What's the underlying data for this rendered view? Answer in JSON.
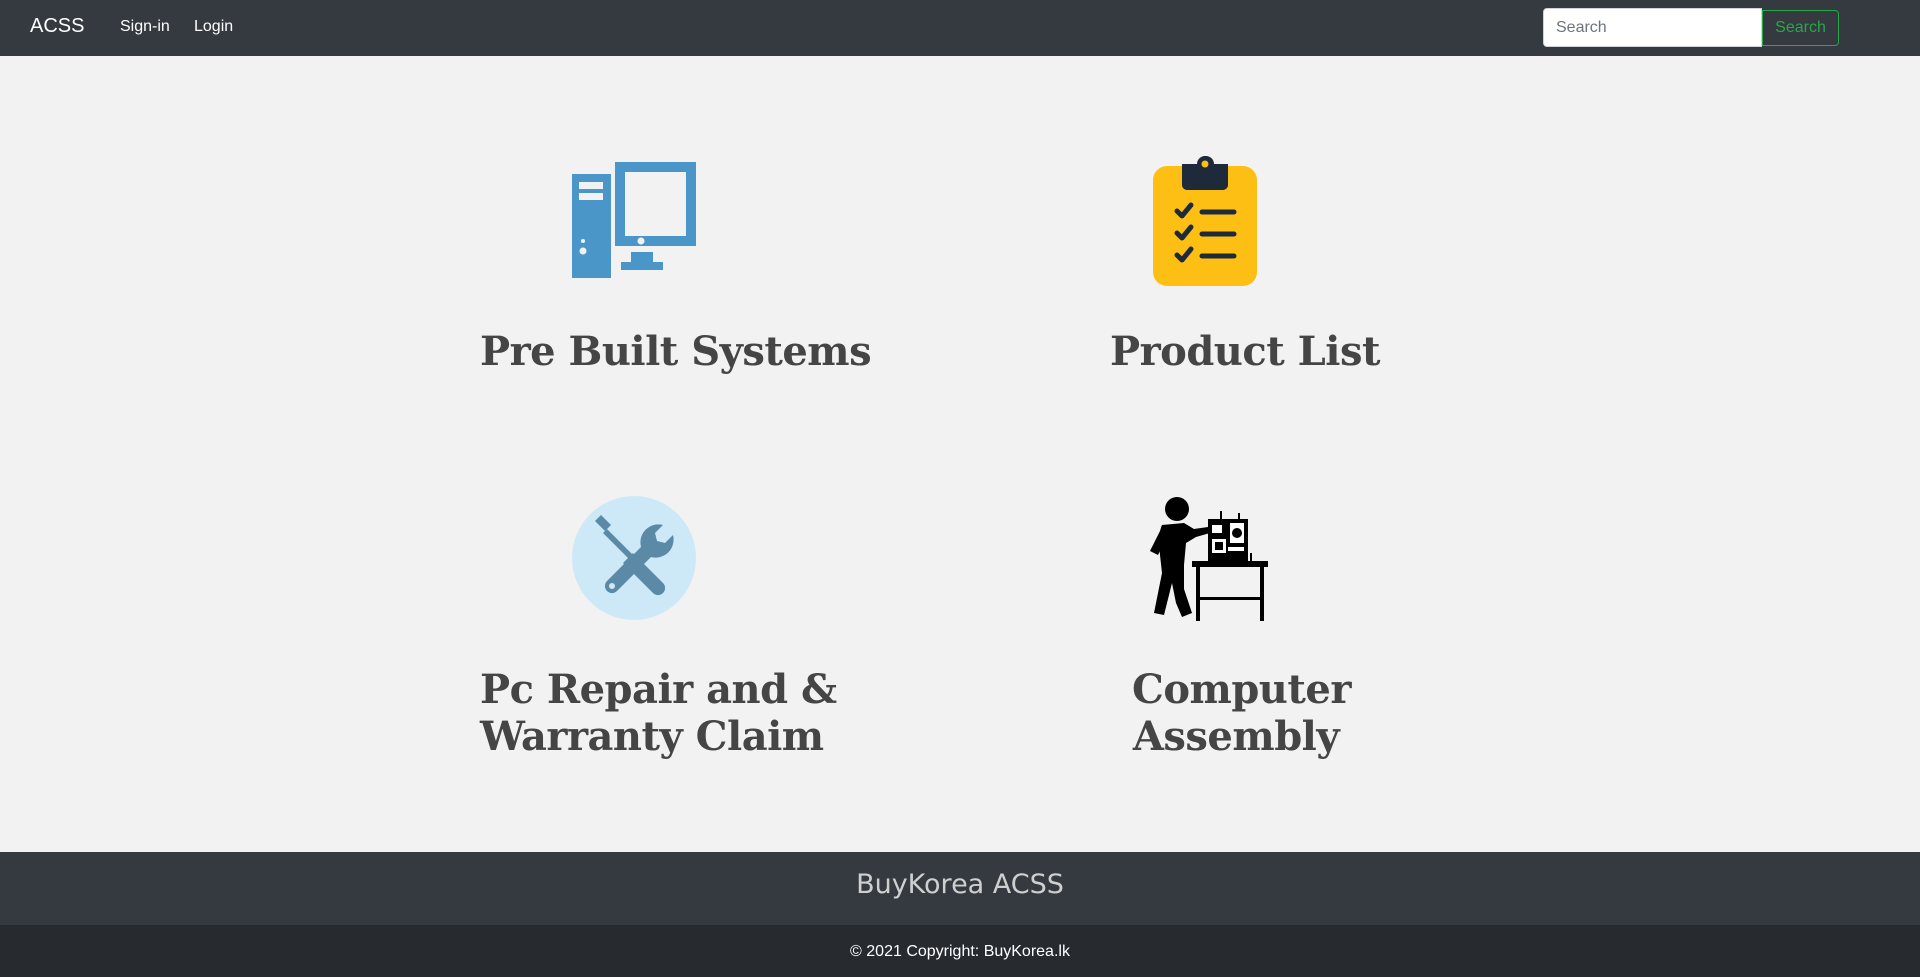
{
  "navbar": {
    "brand": "ACSS",
    "links": [
      "Sign-in",
      "Login"
    ],
    "search": {
      "placeholder": "Search",
      "button_label": "Search"
    }
  },
  "cards": [
    {
      "title_lines": [
        "Pre Built Systems"
      ],
      "icon": "desktop-computer-icon"
    },
    {
      "title_lines": [
        "Product List"
      ],
      "icon": "clipboard-checklist-icon"
    },
    {
      "title_lines": [
        "Pc Repair and &",
        "Warranty Claim"
      ],
      "icon": "tools-repair-icon"
    },
    {
      "title_lines": [
        "Computer",
        "Assembly"
      ],
      "icon": "technician-assembly-icon"
    }
  ],
  "footer": {
    "title": "BuyKorea ACSS",
    "copyright_prefix": "© 2021 Copyright: ",
    "copyright_link": "BuyKorea.lk"
  },
  "colors": {
    "navbar_bg": "#343a40",
    "page_bg": "#f2f2f2",
    "search_accent": "#28a745",
    "computer_icon": "#4a96c8",
    "clipboard_yellow": "#fdbf13",
    "repair_circle": "#cde9f7",
    "repair_tools": "#5a8aa6"
  }
}
